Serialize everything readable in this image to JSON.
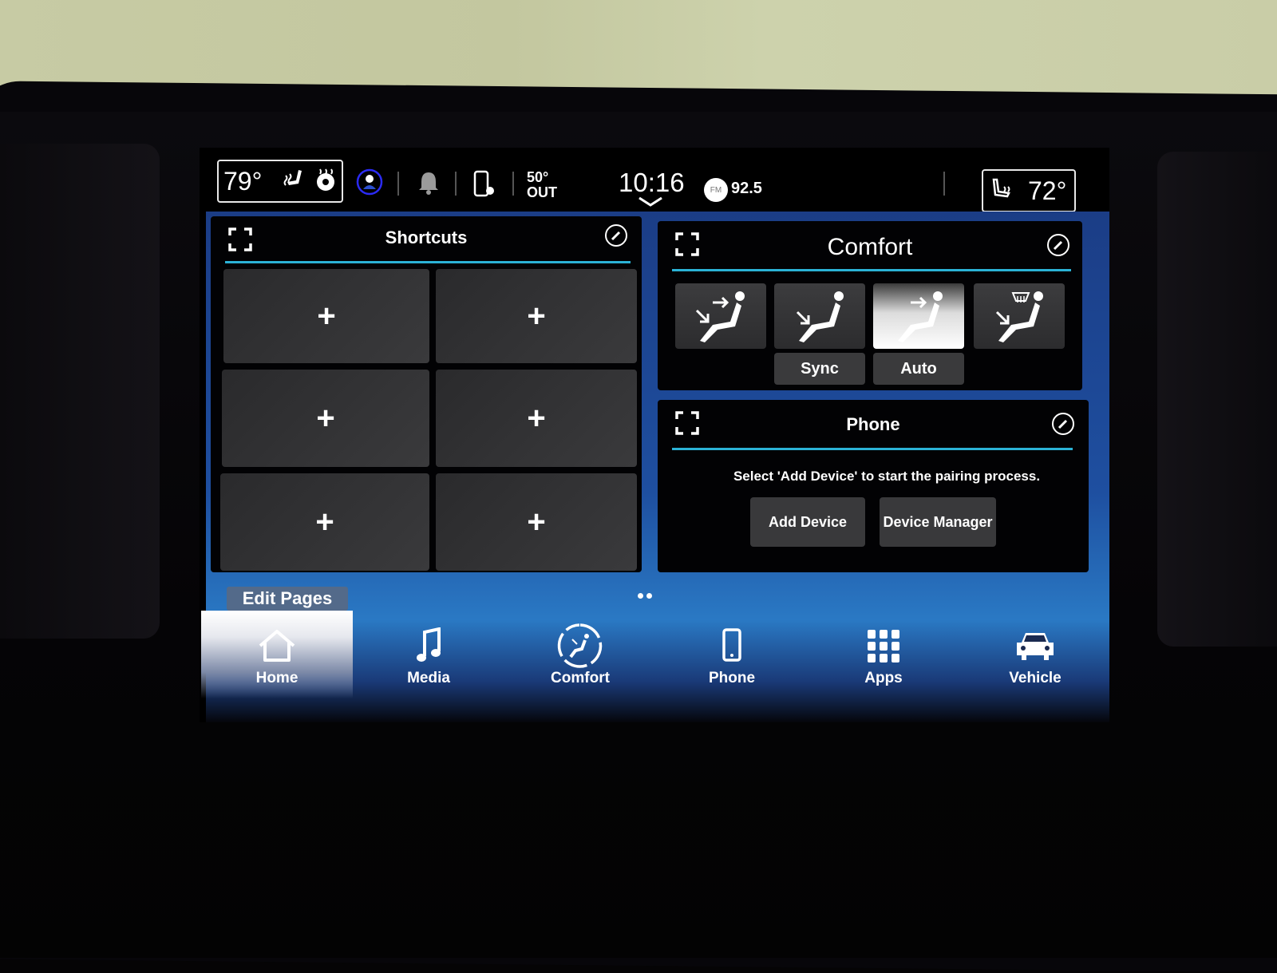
{
  "status_bar": {
    "driver_temp": "79°",
    "passenger_temp": "72°",
    "outside_temp": "50°",
    "outside_label": "OUT",
    "time": "10:16",
    "radio_band": "FM",
    "radio_freq": "92.5",
    "icons": [
      "heated-seat-icon",
      "heated-steering-wheel-icon",
      "driver-profile-icon",
      "notification-bell-icon",
      "phone-settings-icon",
      "time-dropdown-chevron-icon",
      "passenger-heated-seat-icon"
    ]
  },
  "shortcuts": {
    "title": "Shortcuts",
    "tiles": [
      "+",
      "+",
      "+",
      "+",
      "+",
      "+"
    ]
  },
  "comfort": {
    "title": "Comfort",
    "modes": [
      {
        "icon": "seat-airflow-face-feet-icon",
        "label": ""
      },
      {
        "icon": "seat-airflow-feet-icon",
        "label": "Sync"
      },
      {
        "icon": "seat-airflow-face-icon",
        "label": "Auto",
        "active": true
      },
      {
        "icon": "seat-airflow-defrost-feet-icon",
        "label": ""
      }
    ]
  },
  "phone": {
    "title": "Phone",
    "message": "Select 'Add Device' to start the pairing process.",
    "add_device": "Add Device",
    "device_manager": "Device Manager"
  },
  "edit_pages": "Edit Pages",
  "page_indicator": {
    "pages": 2
  },
  "nav": {
    "items": [
      {
        "label": "Home",
        "icon": "home-icon",
        "active": true
      },
      {
        "label": "Media",
        "icon": "music-note-icon"
      },
      {
        "label": "Comfort",
        "icon": "comfort-seat-icon"
      },
      {
        "label": "Phone",
        "icon": "phone-icon"
      },
      {
        "label": "Apps",
        "icon": "apps-grid-icon"
      },
      {
        "label": "Vehicle",
        "icon": "vehicle-icon"
      }
    ]
  }
}
